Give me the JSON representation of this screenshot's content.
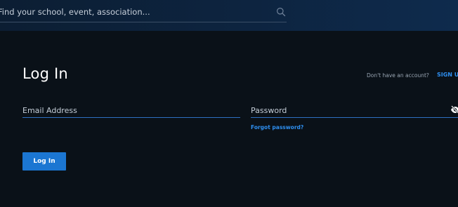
{
  "search": {
    "placeholder": "Find your school, event, association..."
  },
  "login": {
    "title": "Log In",
    "signup_prompt": "Don't have an account?",
    "signup_link": "SIGN UP",
    "email_placeholder": "Email Address",
    "password_placeholder": "Password",
    "forgot_password": "Forgot password?",
    "submit_label": "Log In"
  },
  "colors": {
    "background": "#0a1118",
    "accent": "#1b76d2",
    "link": "#2e8ff0"
  },
  "icons": {
    "search": "search-icon",
    "password_visibility": "eye-slash-icon"
  }
}
